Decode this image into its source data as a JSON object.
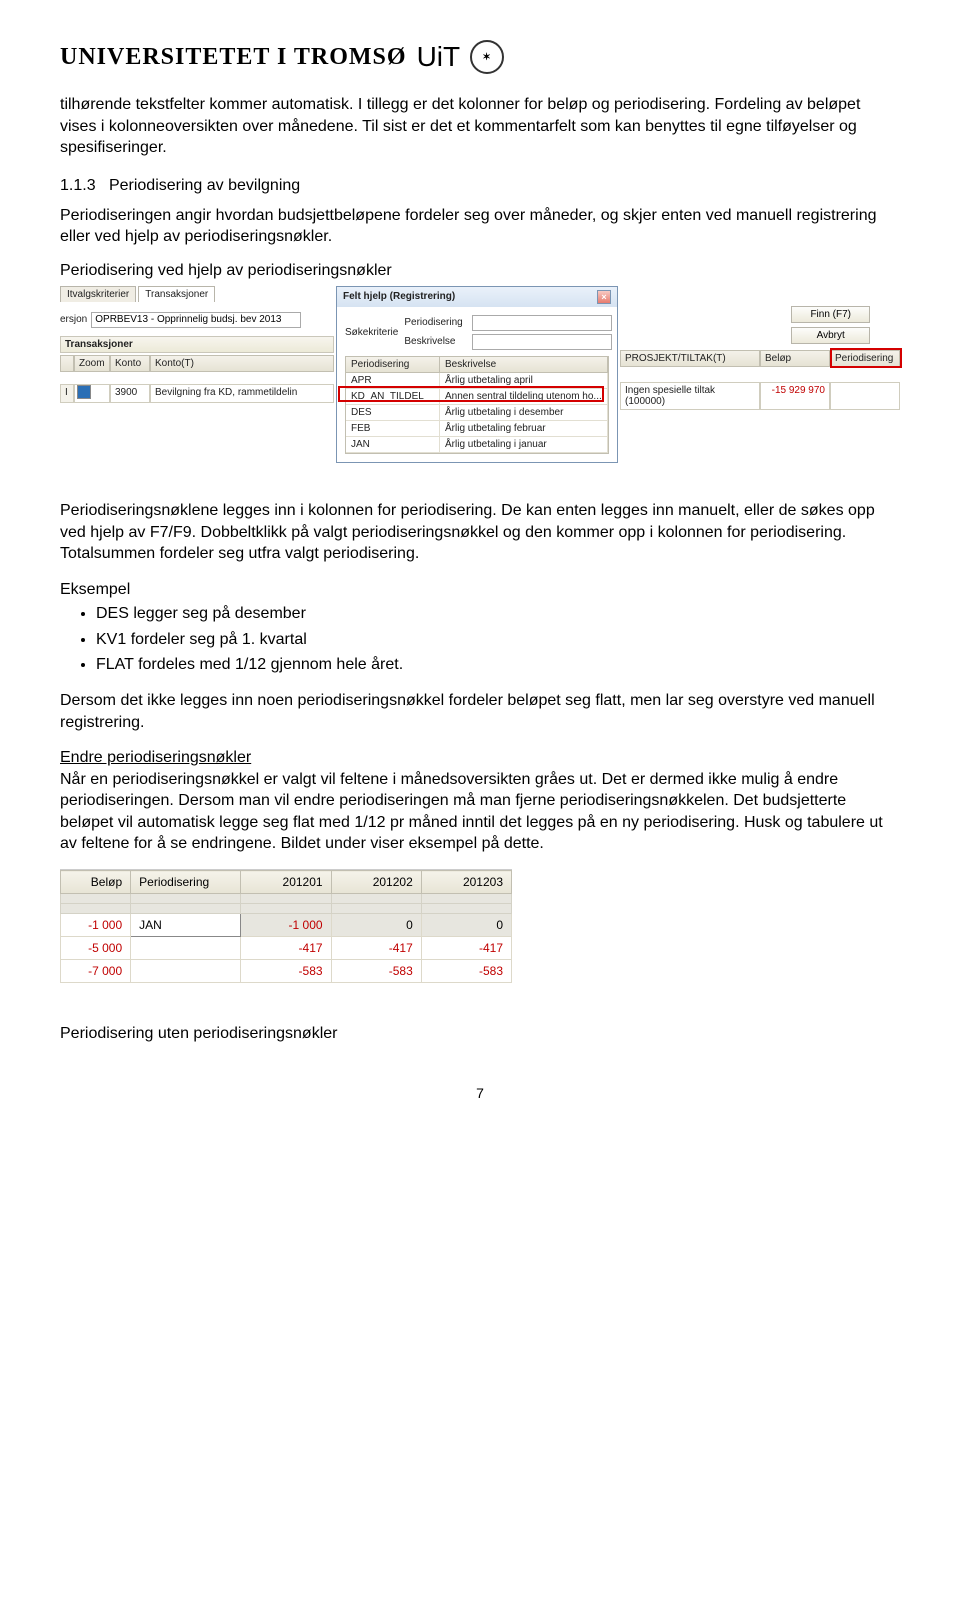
{
  "header": {
    "university": "UNIVERSITETET I TROMSØ",
    "uit": "UiT"
  },
  "p1": "tilhørende tekstfelter kommer automatisk. I tillegg er det kolonner for beløp og periodisering. Fordeling av beløpet vises i kolonneoversikten over månedene.  Til sist er det et kommentarfelt som kan benyttes til egne tilføyelser og spesifiseringer.",
  "section": {
    "num": "1.1.3",
    "title": "Periodisering av bevilgning"
  },
  "p2": "Periodiseringen angir hvordan budsjettbeløpene fordeler seg over måneder, og skjer enten ved manuell registrering eller ved hjelp av periodiseringsnøkler.",
  "p3": "Periodisering ved hjelp av periodiseringsnøkler",
  "shot1": {
    "tab1": "Itvalgskriterier",
    "tab2": "Transaksjoner",
    "versjon_label": "ersjon",
    "versjon_value": "OPRBEV13 - Opprinnelig budsj. bev 2013",
    "trans_head": "Transaksjoner",
    "th_zoom": "Zoom",
    "th_konto": "Konto",
    "th_konto_t": "Konto(T)",
    "td_konto": "3900",
    "td_konto_t": "Bevilgning fra KD, rammetildelin",
    "modal_title": "Felt hjelp (Registrering)",
    "sokekriterie": "Søkekriterie",
    "lbl_periodisering": "Periodisering",
    "lbl_beskrivelse": "Beskrivelse",
    "btn_finn": "Finn (F7)",
    "btn_avbryt": "Avbryt",
    "grid": {
      "h1": "Periodisering",
      "h2": "Beskrivelse",
      "rows": [
        {
          "k": "APR",
          "b": "Årlig utbetaling april"
        },
        {
          "k": "KD_AN_TILDEL",
          "b": "Annen sentral tildeling utenom ho..."
        },
        {
          "k": "DES",
          "b": "Årlig utbetaling i desember"
        },
        {
          "k": "FEB",
          "b": "Årlig utbetaling februar"
        },
        {
          "k": "JAN",
          "b": "Årlig utbetaling i januar"
        }
      ]
    },
    "th_prosjekt": "PROSJEKT/TILTAK(T)",
    "th_belop": "Beløp",
    "th_period": "Periodisering",
    "td_prosjekt": "Ingen spesielle tiltak (100000)",
    "td_belop": "-15 929 970"
  },
  "p4": "Periodiseringsnøklene legges inn i kolonnen for periodisering. De kan enten legges inn manuelt, eller de søkes opp ved hjelp av F7/F9. Dobbeltklikk på valgt periodiseringsnøkkel og den kommer opp i kolonnen for periodisering. Totalsummen fordeler seg utfra valgt periodisering.",
  "p5": "Eksempel",
  "bullets": [
    "DES legger seg på desember",
    "KV1 fordeler seg på 1. kvartal",
    "FLAT fordeles med 1/12 gjennom hele året."
  ],
  "p6": "Dersom det ikke legges inn noen periodiseringsnøkkel fordeler beløpet seg flatt, men lar seg overstyre ved manuell registrering.",
  "p7h": "Endre periodiseringsnøkler",
  "p7": "Når en periodiseringsnøkkel er valgt vil feltene i månedsoversikten gråes ut. Det er dermed ikke mulig å endre periodiseringen. Dersom man vil endre periodiseringen må man fjerne periodiseringsnøkkelen.  Det budsjetterte beløpet vil automatisk legge seg flat med 1/12 pr måned inntil det legges på en ny periodisering.  Husk og tabulere ut av feltene for å se endringene. Bildet under viser eksempel på dette.",
  "shot2": {
    "headers": [
      "Beløp",
      "Periodisering",
      "201201",
      "201202",
      "201203"
    ],
    "rows": [
      {
        "belop": "-1 000",
        "per": "JAN",
        "c1": "-1 000",
        "c2": "0",
        "c3": "0"
      },
      {
        "belop": "-5 000",
        "per": "",
        "c1": "-417",
        "c2": "-417",
        "c3": "-417"
      },
      {
        "belop": "-7 000",
        "per": "",
        "c1": "-583",
        "c2": "-583",
        "c3": "-583"
      }
    ]
  },
  "p8": "Periodisering uten periodiseringsnøkler",
  "page_no": "7"
}
